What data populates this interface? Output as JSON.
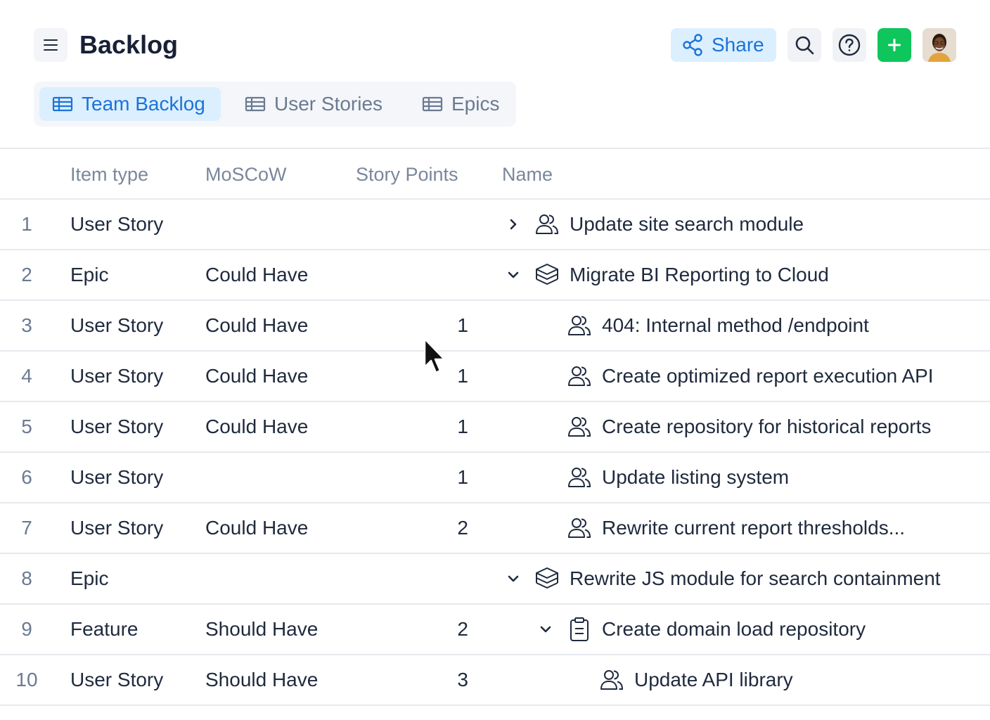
{
  "header": {
    "title": "Backlog",
    "share_label": "Share",
    "accent_color": "#1a73d9",
    "add_color": "#0fc65c"
  },
  "tabs": [
    {
      "label": "Team Backlog",
      "active": true
    },
    {
      "label": "User Stories",
      "active": false
    },
    {
      "label": "Epics",
      "active": false
    }
  ],
  "table": {
    "columns": [
      "Item type",
      "MoSCoW",
      "Story Points",
      "Name"
    ],
    "rows": [
      {
        "num": "1",
        "type": "User Story",
        "moscow": "",
        "points": "",
        "name": "Update site search module",
        "icon": "user-story-icon",
        "toggle": "expand"
      },
      {
        "num": "2",
        "type": "Epic",
        "moscow": "Could Have",
        "points": "",
        "name": "Migrate BI Reporting to Cloud",
        "icon": "epic-icon",
        "toggle": "collapse"
      },
      {
        "num": "3",
        "type": "User Story",
        "moscow": "Could Have",
        "points": "1",
        "name": "404: Internal method /endpoint",
        "icon": "user-story-icon",
        "toggle": ""
      },
      {
        "num": "4",
        "type": "User Story",
        "moscow": "Could Have",
        "points": "1",
        "name": "Create optimized report execution API",
        "icon": "user-story-icon",
        "toggle": ""
      },
      {
        "num": "5",
        "type": "User Story",
        "moscow": "Could Have",
        "points": "1",
        "name": "Create repository for historical reports",
        "icon": "user-story-icon",
        "toggle": ""
      },
      {
        "num": "6",
        "type": "User Story",
        "moscow": "",
        "points": "1",
        "name": "Update listing system",
        "icon": "user-story-icon",
        "toggle": ""
      },
      {
        "num": "7",
        "type": "User Story",
        "moscow": "Could Have",
        "points": "2",
        "name": "Rewrite current report thresholds...",
        "icon": "user-story-icon",
        "toggle": ""
      },
      {
        "num": "8",
        "type": "Epic",
        "moscow": "",
        "points": "",
        "name": "Rewrite JS module for search containment",
        "icon": "epic-icon",
        "toggle": "collapse"
      },
      {
        "num": "9",
        "type": "Feature",
        "moscow": "Should Have",
        "points": "2",
        "name": "Create domain load repository",
        "icon": "feature-icon",
        "toggle": "collapse"
      },
      {
        "num": "10",
        "type": "User Story",
        "moscow": "Should Have",
        "points": "3",
        "name": "Update API library",
        "icon": "user-story-icon",
        "toggle": ""
      }
    ]
  }
}
